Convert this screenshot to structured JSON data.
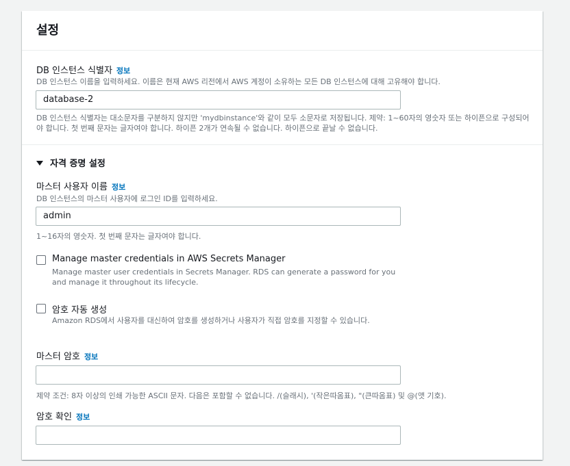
{
  "panel": {
    "title": "설정"
  },
  "info_link": "정보",
  "db_identifier": {
    "label": "DB 인스턴스 식별자",
    "description": "DB 인스턴스 이름을 입력하세요. 이름은 현재 AWS 리전에서 AWS 계정이 소유하는 모든 DB 인스턴스에 대해 고유해야 합니다.",
    "value": "database-2",
    "constraint": "DB 인스턴스 식별자는 대소문자를 구분하지 않지만 'mydbinstance'와 같이 모두 소문자로 저장됩니다. 제약: 1~60자의 영숫자 또는 하이픈으로 구성되어야 합니다. 첫 번째 문자는 글자여야 합니다. 하이픈 2개가 연속될 수 없습니다. 하이픈으로 끝날 수 없습니다."
  },
  "credentials_section": {
    "title": "자격 증명 설정"
  },
  "master_username": {
    "label": "마스터 사용자 이름",
    "description": "DB 인스턴스의 마스터 사용자에 로그인 ID를 입력하세요.",
    "value": "admin",
    "constraint": "1~16자의 영숫자. 첫 번째 문자는 글자여야 합니다."
  },
  "secrets_manager": {
    "label": "Manage master credentials in AWS Secrets Manager",
    "description": "Manage master user credentials in Secrets Manager. RDS can generate a password for you and manage it throughout its lifecycle.",
    "checked": false
  },
  "auto_password": {
    "label": "암호 자동 생성",
    "description": "Amazon RDS에서 사용자를 대신하여 암호를 생성하거나 사용자가 직접 암호를 지정할 수 있습니다.",
    "checked": false
  },
  "master_password": {
    "label": "마스터 암호",
    "value": "",
    "constraint": "제약 조건: 8자 이상의 인쇄 가능한 ASCII 문자. 다음은 포함할 수 없습니다. /(슬래시), '(작은따옴표), \"(큰따옴표) 및 @(앳 기호)."
  },
  "confirm_password": {
    "label": "암호 확인",
    "value": ""
  },
  "colors": {
    "link": "#0073bb",
    "description": "#687078",
    "border": "#aab7b8",
    "background": "#f2f3f3"
  }
}
